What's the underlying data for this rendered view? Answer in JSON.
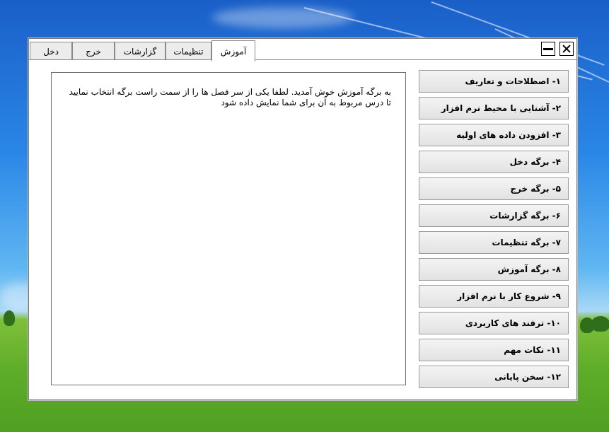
{
  "window": {
    "close_symbol": "✕",
    "minimize_symbol": "—"
  },
  "tabs": [
    {
      "label": "دخل"
    },
    {
      "label": "خرج"
    },
    {
      "label": "گزارشات"
    },
    {
      "label": "تنظیمات"
    },
    {
      "label": "آموزش",
      "active": true
    }
  ],
  "content": {
    "text": "به برگه آموزش خوش آمدید. لطفا یکی از سر فصل ها را از سمت راست برگه انتخاب نمایید تا درس مربوط به آن برای شما نمایش داده شود"
  },
  "lessons": [
    {
      "label": "۱- اصطلاحات و تعاریف"
    },
    {
      "label": "۲- آشنایی با محیط نرم افزار"
    },
    {
      "label": "۳- افزودن داده های اولیه"
    },
    {
      "label": "۴- برگه دخل"
    },
    {
      "label": "۵- برگه خرج"
    },
    {
      "label": "۶- برگه گزارشات"
    },
    {
      "label": "۷- برگه تنظیمات"
    },
    {
      "label": "۸- برگه آموزش"
    },
    {
      "label": "۹- شروع کار با نرم افزار"
    },
    {
      "label": "۱۰- ترفند های کاربردی"
    },
    {
      "label": "۱۱- نکات مهم"
    },
    {
      "label": "۱۲- سخن پایانی"
    }
  ]
}
